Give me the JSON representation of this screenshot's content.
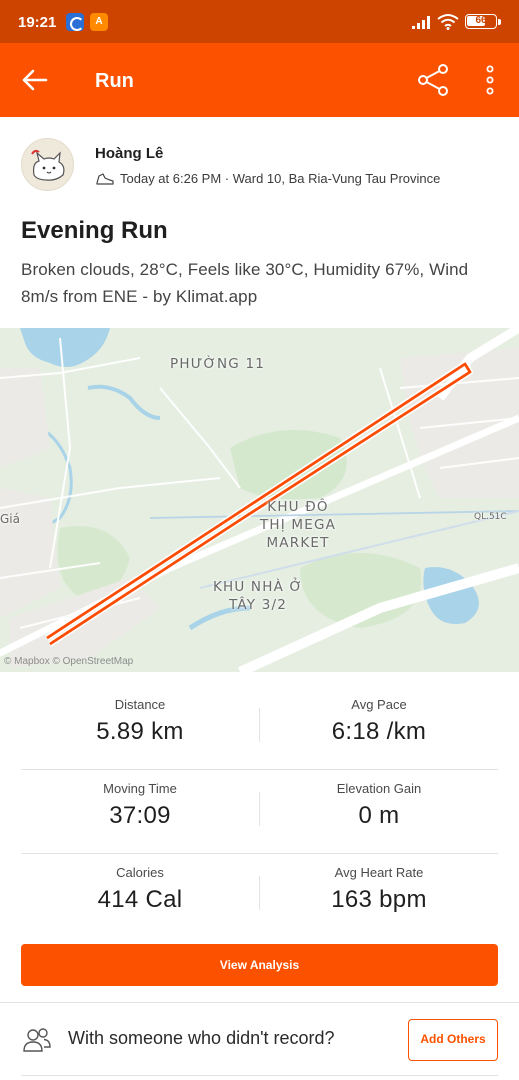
{
  "status_bar": {
    "time": "19:21",
    "battery": "66",
    "battery_fraction": 0.66,
    "icons": [
      "app-sync-icon",
      "app-notification-icon",
      "signal-icon",
      "wifi-icon",
      "battery-icon"
    ]
  },
  "app_bar": {
    "title": "Run",
    "back_icon": "arrow-left-icon",
    "share_icon": "share-icon",
    "more_icon": "more-vertical-icon",
    "color": "#fc5200"
  },
  "athlete": {
    "name": "Hoàng Lê",
    "activity_icon": "shoe-icon",
    "meta": "Today at 6:26 PM · Ward 10, Ba Ria-Vung Tau Province"
  },
  "activity": {
    "title": "Evening Run",
    "description": "Broken clouds, 28°C, Feels like 30°C, Humidity 67%, Wind 8m/s from ENE - by Klimat.app"
  },
  "map": {
    "labels": {
      "ward": "PHƯỜNG 11",
      "district_line1": "KHU ĐÔ",
      "district_line2": "THỊ MEGA",
      "district_line3": "MARKET",
      "area_line1": "KHU NHÀ Ở",
      "area_line2": "TÂY 3/2",
      "road": "QL.51C",
      "edge": "Giá",
      "credit": "© Mapbox © OpenStreetMap"
    },
    "route_color": "#fc4c02"
  },
  "stats": {
    "distance": {
      "label": "Distance",
      "value": "5.89 km"
    },
    "avg_pace": {
      "label": "Avg Pace",
      "value": "6:18 /km"
    },
    "moving_time": {
      "label": "Moving Time",
      "value": "37:09"
    },
    "elevation_gain": {
      "label": "Elevation Gain",
      "value": "0 m"
    },
    "calories": {
      "label": "Calories",
      "value": "414 Cal"
    },
    "avg_heart_rate": {
      "label": "Avg Heart Rate",
      "value": "163 bpm"
    }
  },
  "actions": {
    "view_analysis": "View Analysis",
    "others_prompt": "With someone who didn't record?",
    "add_others": "Add Others",
    "people_icon": "people-icon"
  }
}
